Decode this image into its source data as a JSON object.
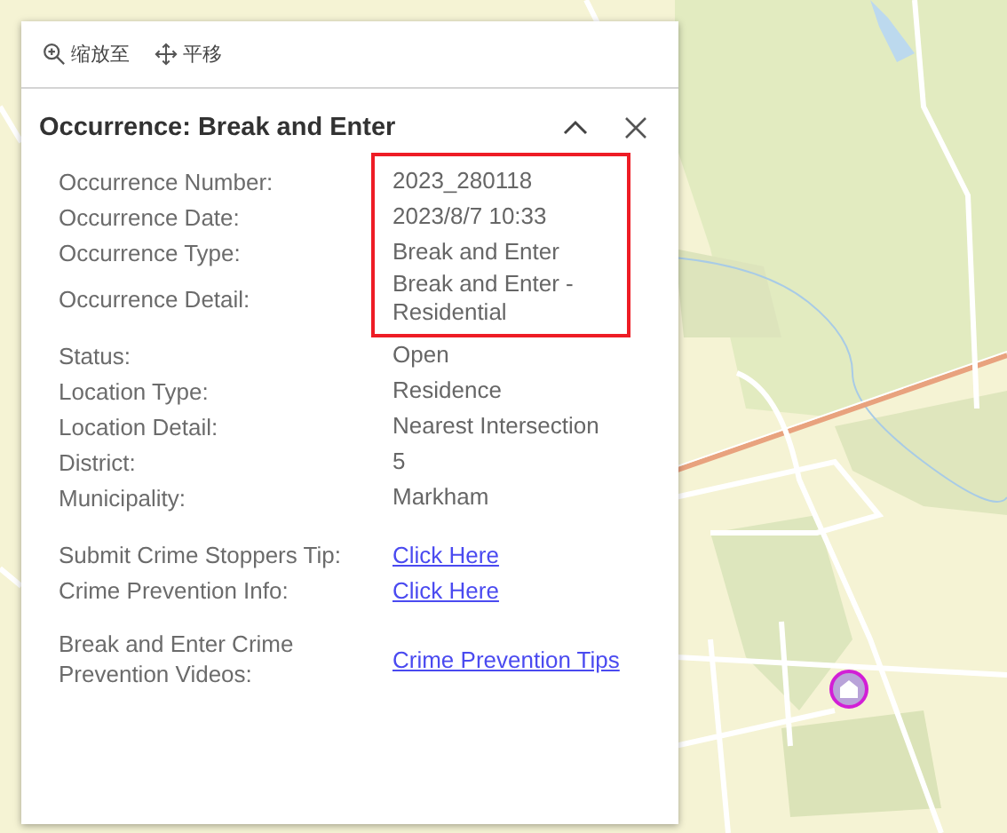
{
  "toolbar": [
    {
      "kind": "zoom",
      "label": "缩放至"
    },
    {
      "kind": "pan",
      "label": "平移"
    }
  ],
  "popup": {
    "title": "Occurrence: Break and Enter",
    "groups": [
      [
        {
          "highlighted": true,
          "rows": [
            {
              "label": "Occurrence Number:",
              "kind": "text",
              "value": "2023_280118"
            },
            {
              "label": "Occurrence Date:",
              "kind": "text",
              "value": "2023/8/7 10:33"
            },
            {
              "label": "Occurrence Type:",
              "kind": "text",
              "value": "Break and Enter"
            },
            {
              "label": "Occurrence Detail:",
              "kind": "text",
              "value": "Break and Enter - Residential"
            }
          ]
        },
        {
          "highlighted": false,
          "rows": [
            {
              "label": "Status:",
              "kind": "text",
              "value": "Open"
            },
            {
              "label": "Location Type:",
              "kind": "text",
              "value": "Residence"
            },
            {
              "label": "Location Detail:",
              "kind": "text",
              "value": "Nearest Intersection"
            },
            {
              "label": "District:",
              "kind": "text",
              "value": "5"
            },
            {
              "label": "Municipality:",
              "kind": "text",
              "value": "Markham"
            }
          ]
        }
      ],
      [
        {
          "highlighted": false,
          "rows": [
            {
              "label": "Submit Crime Stoppers Tip:",
              "kind": "link",
              "value": "Click Here"
            },
            {
              "label": "Crime Prevention Info:",
              "kind": "link",
              "value": "Click Here"
            }
          ]
        }
      ],
      [
        {
          "highlighted": false,
          "rows": [
            {
              "label": "Break and Enter Crime Prevention Videos:",
              "kind": "link",
              "value": "Crime Prevention Tips"
            }
          ]
        }
      ]
    ]
  }
}
